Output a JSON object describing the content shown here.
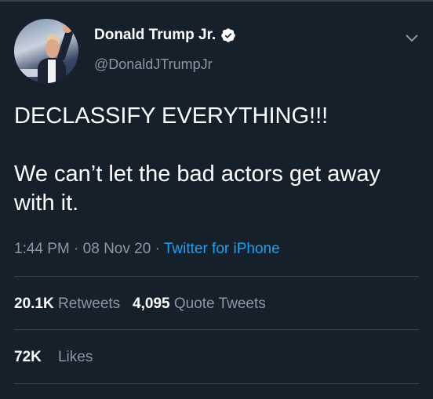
{
  "user": {
    "name": "Donald Trump Jr.",
    "handle": "@DonaldJTrumpJr"
  },
  "tweet": {
    "line1": "DECLASSIFY EVERYTHING!!!",
    "line2": "We can’t let the bad actors get away with it."
  },
  "meta": {
    "time": "1:44 PM",
    "sep1": "·",
    "date": "08 Nov 20",
    "sep2": "·",
    "source": "Twitter for iPhone"
  },
  "stats": {
    "retweets_count": "20.1K",
    "retweets_label": "Retweets",
    "quotes_count": "4,095",
    "quotes_label": "Quote Tweets",
    "likes_count": "72K",
    "likes_label": "Likes"
  },
  "icons": {
    "verified": "verified-badge-icon",
    "caret": "chevron-down-icon"
  },
  "colors": {
    "background": "#15202b",
    "secondary_text": "#8899a6",
    "link": "#1da1f2",
    "divider": "#38444d"
  }
}
